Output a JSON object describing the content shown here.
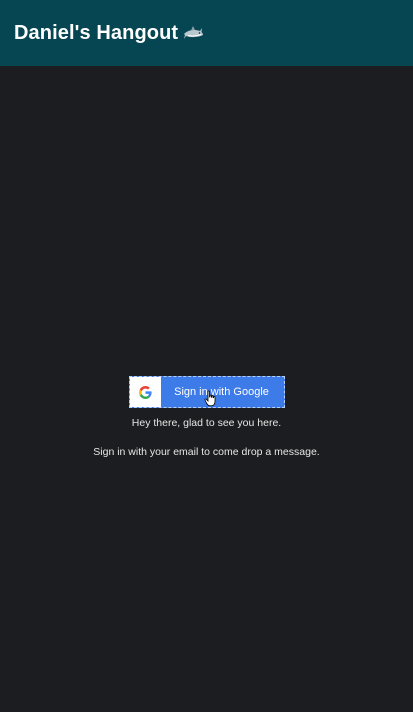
{
  "header": {
    "title": "Daniel's Hangout",
    "icon": "shark-icon",
    "background": "#064652"
  },
  "signin": {
    "button_label": "Sign in with Google",
    "provider_icon": "google-icon",
    "button_color": "#3d7be8"
  },
  "messages": {
    "greeting": "Hey there, glad to see you here.",
    "instruction": "Sign in with your email to come drop a message."
  },
  "theme": {
    "page_background": "#1c1d20",
    "text_color": "#e6e6e6"
  }
}
